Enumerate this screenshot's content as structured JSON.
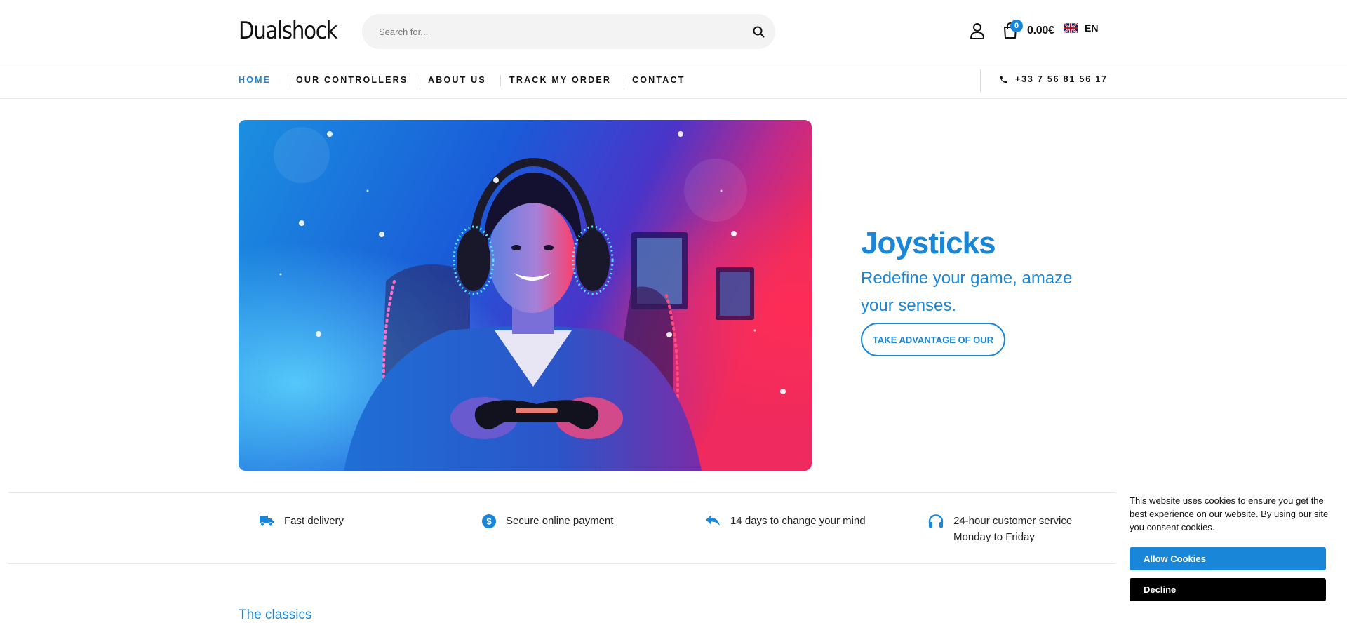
{
  "header": {
    "logo": "Dualshock",
    "search_placeholder": "Search for...",
    "cart_count": "0",
    "cart_total": "0.00€",
    "language": "EN"
  },
  "nav": {
    "items": [
      {
        "label": "HOME",
        "active": true
      },
      {
        "label": "OUR CONTROLLERS",
        "active": false
      },
      {
        "label": "ABOUT US",
        "active": false
      },
      {
        "label": "TRACK MY ORDER",
        "active": false
      },
      {
        "label": "CONTACT",
        "active": false
      }
    ],
    "phone": "+33 7 56 81 56 17"
  },
  "hero": {
    "title": "Joysticks",
    "subtitle": "Redefine your game, amaze your senses.",
    "button": "TAKE ADVANTAGE OF OUR"
  },
  "features": [
    {
      "icon": "truck-icon",
      "text": "Fast delivery"
    },
    {
      "icon": "dollar-icon",
      "text": "Secure online payment"
    },
    {
      "icon": "reply-icon",
      "text": "14 days to change your mind"
    },
    {
      "icon": "headphones-icon",
      "text": "24-hour customer service",
      "text2": "Monday to Friday"
    }
  ],
  "section": {
    "title": "The classics"
  },
  "cookie": {
    "text": "This website uses cookies to ensure you get the best experience on our website. By using our site you consent cookies.",
    "allow": "Allow Cookies",
    "decline": "Decline"
  },
  "colors": {
    "accent": "#1a86d8",
    "text": "#111111",
    "border": "#e6e6e6"
  }
}
